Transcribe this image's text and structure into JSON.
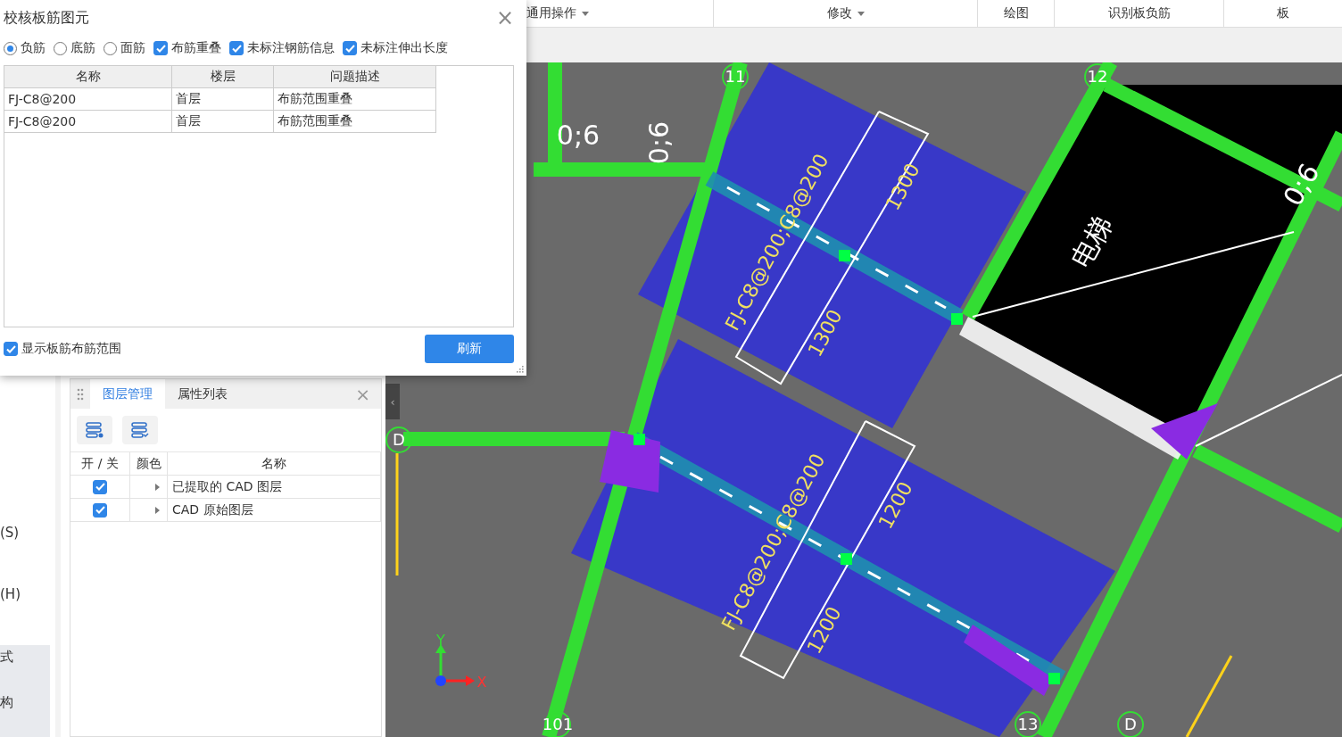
{
  "dialog": {
    "title": "校核板筋图元",
    "close": "×",
    "options": [
      {
        "kind": "radio",
        "label": "负筋",
        "selected": true
      },
      {
        "kind": "radio",
        "label": "底筋",
        "selected": false
      },
      {
        "kind": "radio",
        "label": "面筋",
        "selected": false
      },
      {
        "kind": "checkbox",
        "label": "布筋重叠",
        "checked": true
      },
      {
        "kind": "checkbox",
        "label": "未标注钢筋信息",
        "checked": true
      },
      {
        "kind": "checkbox",
        "label": "未标注伸出长度",
        "checked": true
      }
    ],
    "table": {
      "columns": [
        "名称",
        "楼层",
        "问题描述"
      ],
      "rows": [
        [
          "FJ-C8@200",
          "首层",
          "布筋范围重叠"
        ],
        [
          "FJ-C8@200",
          "首层",
          "布筋范围重叠"
        ]
      ]
    },
    "footer_checkbox": {
      "label": "显示板筋布筋范围",
      "checked": true
    },
    "refresh_button": "刷新"
  },
  "toolbar": {
    "groups": [
      {
        "label": "通用操作",
        "dropdown": true
      },
      {
        "label": "修改",
        "dropdown": true
      },
      {
        "label": "绘图",
        "dropdown": false
      },
      {
        "label": "识别板负筋",
        "dropdown": false
      },
      {
        "label": "板",
        "dropdown": false
      }
    ]
  },
  "nav": {
    "items": [
      {
        "label": "(S)",
        "selected": false
      },
      {
        "label": "(H)",
        "selected": false
      },
      {
        "label": "式",
        "selected": true
      },
      {
        "label": "构",
        "selected": true
      }
    ]
  },
  "layer_panel": {
    "tabs": [
      {
        "label": "图层管理",
        "selected": true
      },
      {
        "label": "属性列表",
        "selected": false
      }
    ],
    "close": "×",
    "columns": [
      "开 / 关",
      "颜色",
      "名称"
    ],
    "rows": [
      {
        "on": true,
        "name": "已提取的 CAD 图层"
      },
      {
        "on": true,
        "name": "CAD 原始图层"
      }
    ]
  },
  "cad": {
    "collapse_handle": "‹",
    "labels": [
      {
        "kind": "axis",
        "text": "11"
      },
      {
        "kind": "axis",
        "text": "12"
      },
      {
        "kind": "note",
        "text": "0;6"
      },
      {
        "kind": "note",
        "text": "0;6"
      },
      {
        "kind": "note",
        "text": "0;6"
      },
      {
        "kind": "dimension",
        "text": "1300"
      },
      {
        "kind": "rebar",
        "text": "FJ-C8@200;C8@200"
      },
      {
        "kind": "room",
        "text": "电梯"
      },
      {
        "kind": "dimension",
        "text": "1300"
      },
      {
        "kind": "axis",
        "text": "D"
      },
      {
        "kind": "dimension",
        "text": "1200"
      },
      {
        "kind": "rebar",
        "text": "FJ-C8@200;C8@200"
      },
      {
        "kind": "dimension",
        "text": "1200"
      },
      {
        "kind": "y-axis",
        "text": "Y"
      },
      {
        "kind": "x-axis",
        "text": "X"
      },
      {
        "kind": "axis",
        "text": "101"
      },
      {
        "kind": "axis",
        "text": "13"
      },
      {
        "kind": "axis",
        "text": "D"
      }
    ]
  }
}
